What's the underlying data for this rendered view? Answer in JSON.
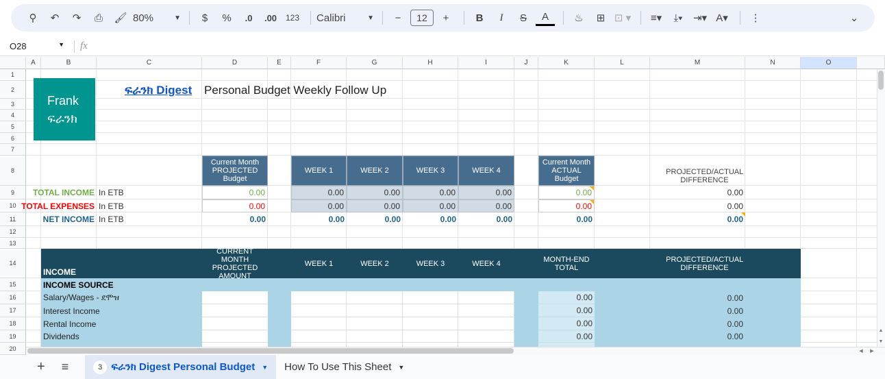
{
  "toolbar": {
    "zoom": "80%",
    "currency": "$",
    "percent": "%",
    "dec_decrease": ".0",
    "dec_increase": ".00",
    "format_123": "123",
    "font": "Calibri",
    "font_size": "12"
  },
  "formula_bar": {
    "name_box": "O28",
    "fx": "fx"
  },
  "columns": [
    "A",
    "B",
    "C",
    "D",
    "E",
    "F",
    "G",
    "H",
    "I",
    "J",
    "K",
    "L",
    "M",
    "N",
    "O"
  ],
  "rows": [
    "1",
    "2",
    "3",
    "4",
    "5",
    "6",
    "7",
    "8",
    "9",
    "10",
    "11",
    "12",
    "13",
    "14",
    "15",
    "16",
    "17",
    "18",
    "19",
    "20"
  ],
  "logo": {
    "line1": "Frank",
    "line2": "ፍራንክ"
  },
  "title": {
    "link": "ፍራንክ Digest",
    "text": "Personal Budget Weekly Follow Up"
  },
  "summary": {
    "headers": {
      "projected": "Current Month PROJECTED Budget",
      "weeks": [
        "WEEK 1",
        "WEEK 2",
        "WEEK 3",
        "WEEK 4"
      ],
      "actual": "Current Month ACTUAL Budget",
      "diff": "PROJECTED/ACTUAL DIFFERENCE"
    },
    "rows": [
      {
        "label": "TOTAL INCOME",
        "unit": "In ETB",
        "projected": "0.00",
        "weeks": [
          "0.00",
          "0.00",
          "0.00",
          "0.00"
        ],
        "actual": "0.00",
        "diff": "0.00"
      },
      {
        "label": "TOTAL EXPENSES",
        "unit": "In ETB",
        "projected": "0.00",
        "weeks": [
          "0.00",
          "0.00",
          "0.00",
          "0.00"
        ],
        "actual": "0.00",
        "diff": "0.00"
      },
      {
        "label": "NET INCOME",
        "unit": "In ETB",
        "projected": "0.00",
        "weeks": [
          "0.00",
          "0.00",
          "0.00",
          "0.00"
        ],
        "actual": "0.00",
        "diff": "0.00"
      }
    ],
    "colors": {
      "income": "#70ad47",
      "expenses": "#ff0000",
      "net": "#1f6391"
    }
  },
  "income": {
    "header": {
      "title": "INCOME",
      "projected": "CURRENT MONTH PROJECTED AMOUNT",
      "weeks": [
        "WEEK 1",
        "WEEK 2",
        "WEEK 3",
        "WEEK 4"
      ],
      "month_end": "MONTH-END TOTAL",
      "diff": "PROJECTED/ACTUAL DIFFERENCE"
    },
    "section": "INCOME SOURCE",
    "rows": [
      {
        "label": "Salary/Wages - ደሞዝ",
        "total": "0.00",
        "diff": "0.00"
      },
      {
        "label": "Interest Income",
        "total": "0.00",
        "diff": "0.00"
      },
      {
        "label": "Rental Income",
        "total": "0.00",
        "diff": "0.00"
      },
      {
        "label": "Dividends",
        "total": "0.00",
        "diff": "0.00"
      }
    ]
  },
  "tabs": [
    {
      "label": "ፍራንክ Digest Personal Budget",
      "badge": "3"
    },
    {
      "label": "How To Use This Sheet"
    }
  ]
}
